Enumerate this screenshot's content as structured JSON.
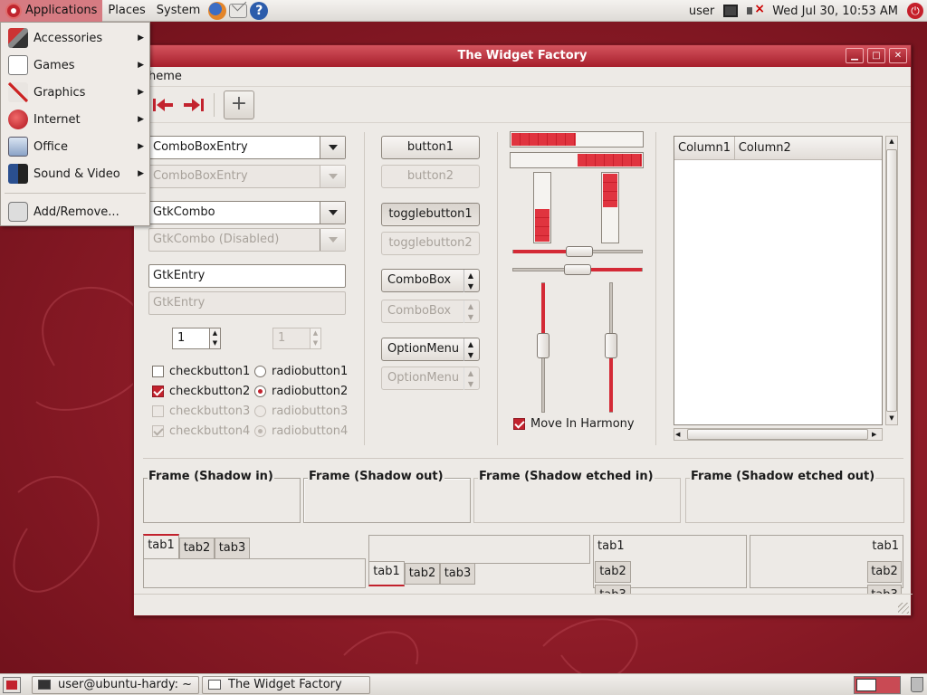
{
  "top_panel": {
    "menus": [
      "Applications",
      "Places",
      "System"
    ],
    "user": "user",
    "clock": "Wed Jul 30, 10:53 AM"
  },
  "apps_menu": {
    "items": [
      {
        "label": "Accessories",
        "icon": "accessories-icon"
      },
      {
        "label": "Games",
        "icon": "games-icon"
      },
      {
        "label": "Graphics",
        "icon": "graphics-icon"
      },
      {
        "label": "Internet",
        "icon": "internet-icon"
      },
      {
        "label": "Office",
        "icon": "office-icon"
      },
      {
        "label": "Sound & Video",
        "icon": "sound-video-icon"
      }
    ],
    "add_remove": "Add/Remove..."
  },
  "window": {
    "title": "The Widget Factory",
    "menu": "heme",
    "col1": {
      "comboboxentry": "ComboBoxEntry",
      "comboboxentry_disabled": "ComboBoxEntry",
      "gtkcombo": "GtkCombo",
      "gtkcombo_disabled": "GtkCombo (Disabled)",
      "gtkentry": "GtkEntry",
      "gtkentry_disabled": "GtkEntry",
      "spin1": "1",
      "spin2": "1",
      "checkbuttons": [
        "checkbutton1",
        "checkbutton2",
        "checkbutton3",
        "checkbutton4"
      ],
      "radiobuttons": [
        "radiobutton1",
        "radiobutton2",
        "radiobutton3",
        "radiobutton4"
      ]
    },
    "col2": {
      "button1": "button1",
      "button2": "button2",
      "togglebutton1": "togglebutton1",
      "togglebutton2": "togglebutton2",
      "combobox": "ComboBox",
      "combobox_disabled": "ComboBox",
      "optionmenu": "OptionMenu",
      "optionmenu_disabled": "OptionMenu"
    },
    "col3": {
      "progress_h1": 0.5,
      "progress_h2": 0.5,
      "progress_v1": 0.5,
      "progress_v2": 0.5,
      "hscale1": 0.5,
      "hscale2": 0.5,
      "vscale1": 0.5,
      "vscale2": 0.5,
      "move_in_harmony": "Move In Harmony"
    },
    "treeview": {
      "columns": [
        "Column1",
        "Column2"
      ]
    },
    "frames": [
      "Frame (Shadow in)",
      "Frame (Shadow out)",
      "Frame (Shadow etched in)",
      "Frame (Shadow etched out)"
    ],
    "tabs": [
      "tab1",
      "tab2",
      "tab3"
    ]
  },
  "taskbar": {
    "tasks": [
      "user@ubuntu-hardy: ~",
      "The Widget Factory"
    ]
  },
  "colors": {
    "accent": "#c2222d",
    "titlebar": "#b8303b"
  }
}
